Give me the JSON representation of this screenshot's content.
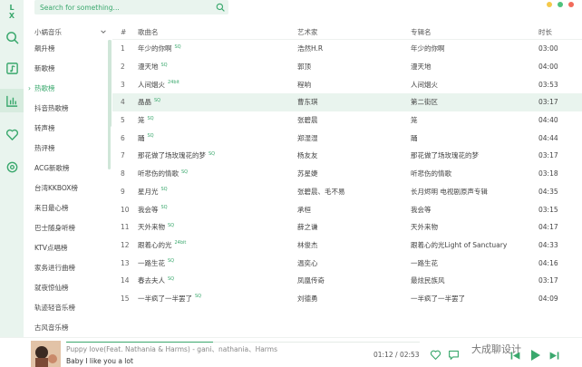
{
  "app": {
    "logo": "L X"
  },
  "search": {
    "placeholder": "Search for something..."
  },
  "sources": {
    "header": "小蜗音乐",
    "items": [
      "飙升榜",
      "新歌榜",
      "热歌榜",
      "抖音热歌榜",
      "转声榜",
      "热评榜",
      "ACG新歌榜",
      "台湾KKBOX榜",
      "来日最心榜",
      "巴士随身听榜",
      "KTV点唱榜",
      "家务进行曲榜",
      "就夜惊仙榜",
      "轨迹轻音乐榜",
      "古风音乐榜"
    ],
    "active_index": 2
  },
  "table": {
    "headers": {
      "num": "#",
      "title": "歌曲名",
      "artist": "艺术家",
      "album": "专辑名",
      "time": "时长"
    },
    "rows": [
      {
        "num": "1",
        "title": "年少的你啊",
        "q": "SQ",
        "artist": "浩然H.R",
        "album": "年少的你啊",
        "time": "03:00"
      },
      {
        "num": "2",
        "title": "漫天地",
        "q": "SQ",
        "artist": "郭顶",
        "album": "漫天地",
        "time": "04:00"
      },
      {
        "num": "3",
        "title": "人间烟火",
        "q": "24bit",
        "artist": "程响",
        "album": "人间烟火",
        "time": "03:53"
      },
      {
        "num": "4",
        "title": "晶晶",
        "q": "SQ",
        "artist": "曹东琪",
        "album": "第二街区",
        "time": "03:17"
      },
      {
        "num": "5",
        "title": "笼",
        "q": "SQ",
        "artist": "张碧晨",
        "album": "笼",
        "time": "04:40"
      },
      {
        "num": "6",
        "title": "踊",
        "q": "SQ",
        "artist": "郑湿湿",
        "album": "踊",
        "time": "04:44"
      },
      {
        "num": "7",
        "title": "那花做了场玫瑰花的梦",
        "q": "SQ",
        "artist": "杨友友",
        "album": "那花做了场玫瑰花的梦",
        "time": "03:17"
      },
      {
        "num": "8",
        "title": "听悲伤的情歌",
        "q": "SQ",
        "artist": "苏星婕",
        "album": "听悲伤的情歌",
        "time": "03:18"
      },
      {
        "num": "9",
        "title": "星月光",
        "q": "SQ",
        "artist": "张碧晨、毛不易",
        "album": "长月烬明 电视剧原声专辑",
        "time": "04:35"
      },
      {
        "num": "10",
        "title": "我会等",
        "q": "SQ",
        "artist": "承桓",
        "album": "我会等",
        "time": "03:15"
      },
      {
        "num": "11",
        "title": "天外来物",
        "q": "SQ",
        "artist": "薛之谦",
        "album": "天外来物",
        "time": "04:17"
      },
      {
        "num": "12",
        "title": "跟着心的光",
        "q": "24bit",
        "artist": "林俊杰",
        "album": "跟着心的光Light of Sanctuary",
        "time": "04:33"
      },
      {
        "num": "13",
        "title": "一路生花",
        "q": "SQ",
        "artist": "温奕心",
        "album": "一路生花",
        "time": "04:16"
      },
      {
        "num": "14",
        "title": "春去夫人",
        "q": "SQ",
        "artist": "凤凰传奇",
        "album": "最炫民族风",
        "time": "03:17"
      },
      {
        "num": "15",
        "title": "一半疯了一半罢了",
        "q": "SQ",
        "artist": "刘德勇",
        "album": "一半疯了一半罢了",
        "time": "04:09"
      }
    ],
    "active_index": 3
  },
  "player": {
    "song": "Puppy love(Feat. Nathania & Harms) - gani、nathania、Harms",
    "lyric": "Baby I like you a lot",
    "current": "01:12",
    "separator": "/",
    "total": "02:53",
    "progress": 0.416
  },
  "watermark": {
    "text": "大成聊设计"
  },
  "colors": {
    "accent": "#3aa86d",
    "rail_bg": "#e9f4ee",
    "active_row": "#e9f4ee"
  },
  "icons": {
    "rail": [
      "search-icon",
      "library-icon",
      "chart-icon",
      "heart-icon",
      "settings-icon"
    ],
    "player": [
      "heart-icon",
      "comment-icon",
      "prev-icon",
      "play-icon",
      "next-icon"
    ]
  }
}
